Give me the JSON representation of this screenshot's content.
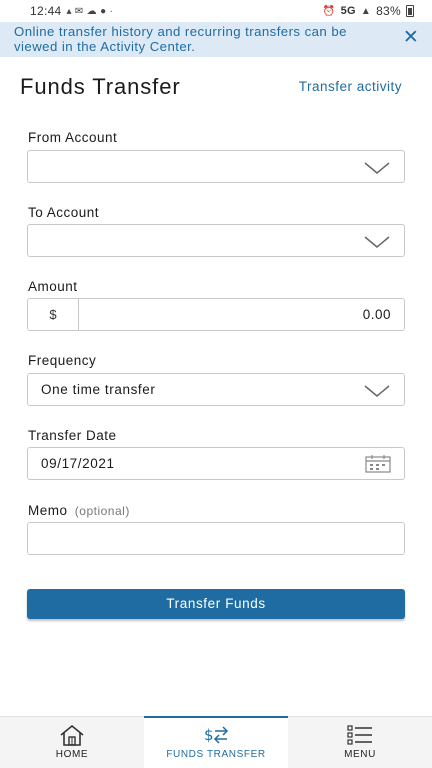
{
  "status_bar": {
    "time": "12:44",
    "network": "5G",
    "battery": "83%"
  },
  "notice": {
    "text": "Online transfer history and recurring transfers can be viewed in the Activity Center.",
    "close_icon": "close-icon"
  },
  "header": {
    "title": "Funds Transfer",
    "activity_link": "Transfer activity"
  },
  "form": {
    "from_account": {
      "label": "From Account",
      "value": ""
    },
    "to_account": {
      "label": "To Account",
      "value": ""
    },
    "amount": {
      "label": "Amount",
      "prefix": "$",
      "value": "0.00"
    },
    "frequency": {
      "label": "Frequency",
      "value": "One time transfer"
    },
    "transfer_date": {
      "label": "Transfer Date",
      "value": "09/17/2021"
    },
    "memo": {
      "label": "Memo",
      "optional": "(optional)",
      "value": ""
    },
    "submit_label": "Transfer Funds"
  },
  "nav": {
    "items": [
      {
        "label": "HOME",
        "icon": "home-icon"
      },
      {
        "label": "FUNDS TRANSFER",
        "icon": "transfer-icon",
        "active": true
      },
      {
        "label": "MENU",
        "icon": "menu-icon"
      }
    ]
  },
  "colors": {
    "accent": "#1f6ca2",
    "banner_bg": "#ddeaf5"
  }
}
